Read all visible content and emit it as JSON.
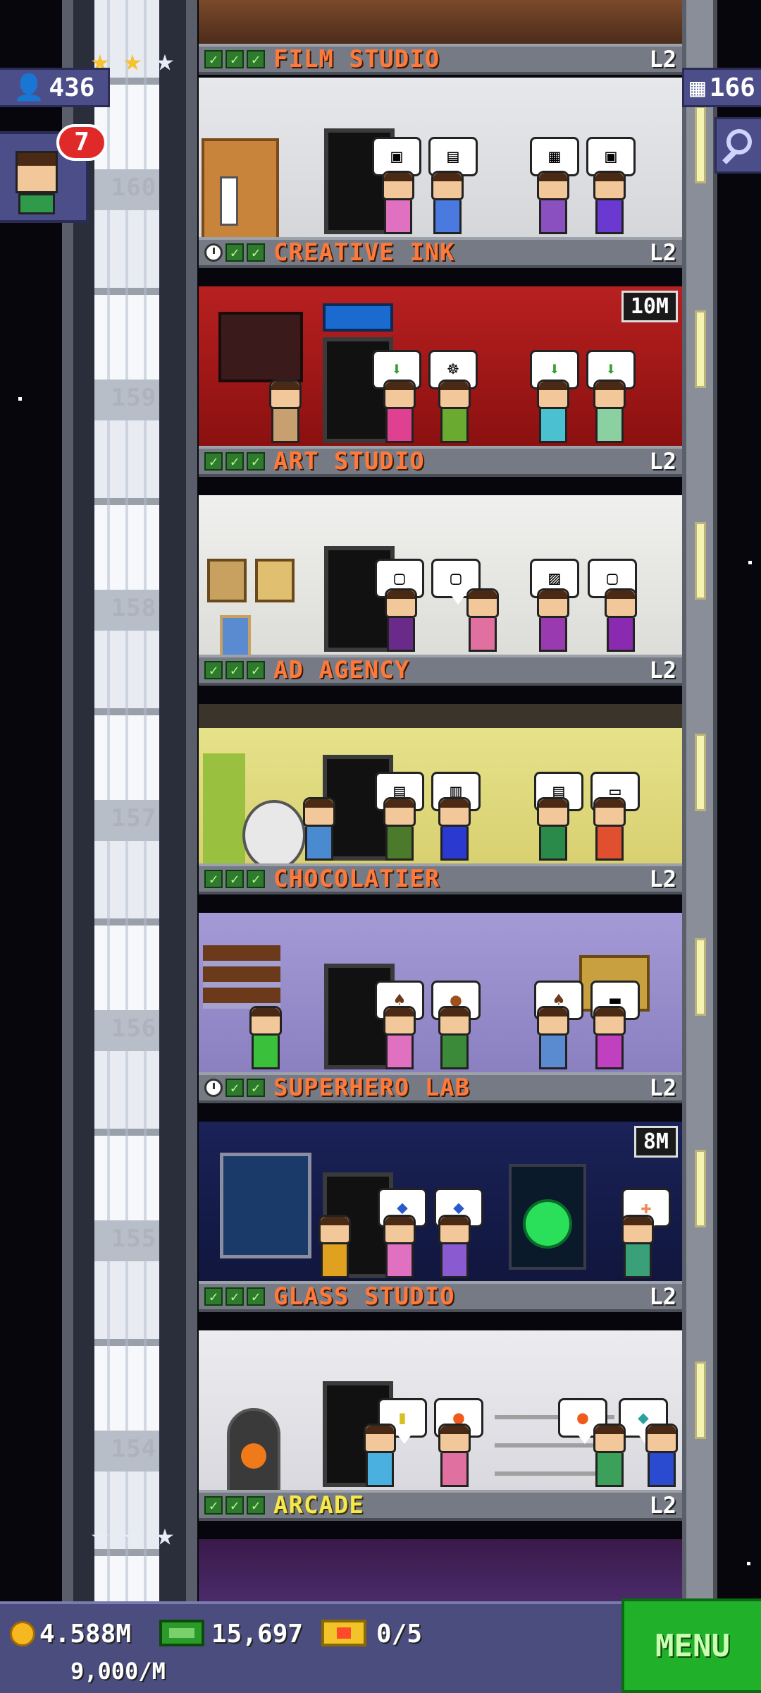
{
  "hud": {
    "population": "436",
    "floors_count": "166",
    "notification_count": "7"
  },
  "floors": [
    {
      "number": "160",
      "name": "CREATIVE INK",
      "level": "L2"
    },
    {
      "number": "159",
      "name": "ART STUDIO",
      "level": "L2",
      "timer": "10M"
    },
    {
      "number": "158",
      "name": "AD AGENCY",
      "level": "L2"
    },
    {
      "number": "157",
      "name": "CHOCOLATIER",
      "level": "L2"
    },
    {
      "number": "156",
      "name": "SUPERHERO LAB",
      "level": "L2"
    },
    {
      "number": "155",
      "name": "GLASS STUDIO",
      "level": "L2",
      "timer": "8M"
    },
    {
      "number": "154",
      "name": "ARCADE",
      "level": "L2"
    }
  ],
  "top_floor": {
    "name": "FILM STUDIO",
    "level": "L2"
  },
  "bottom_bar": {
    "coins": "4.588M",
    "income": "9,000/M",
    "bux": "15,697",
    "tickets": "0/5",
    "menu_label": "MENU"
  },
  "colors": {
    "floor_name": "#ff7a3a",
    "arcade_name": "#f6e84a",
    "hud_panel": "#4c4e8a",
    "menu_button": "#20b02a",
    "notification": "#e02a2a"
  }
}
